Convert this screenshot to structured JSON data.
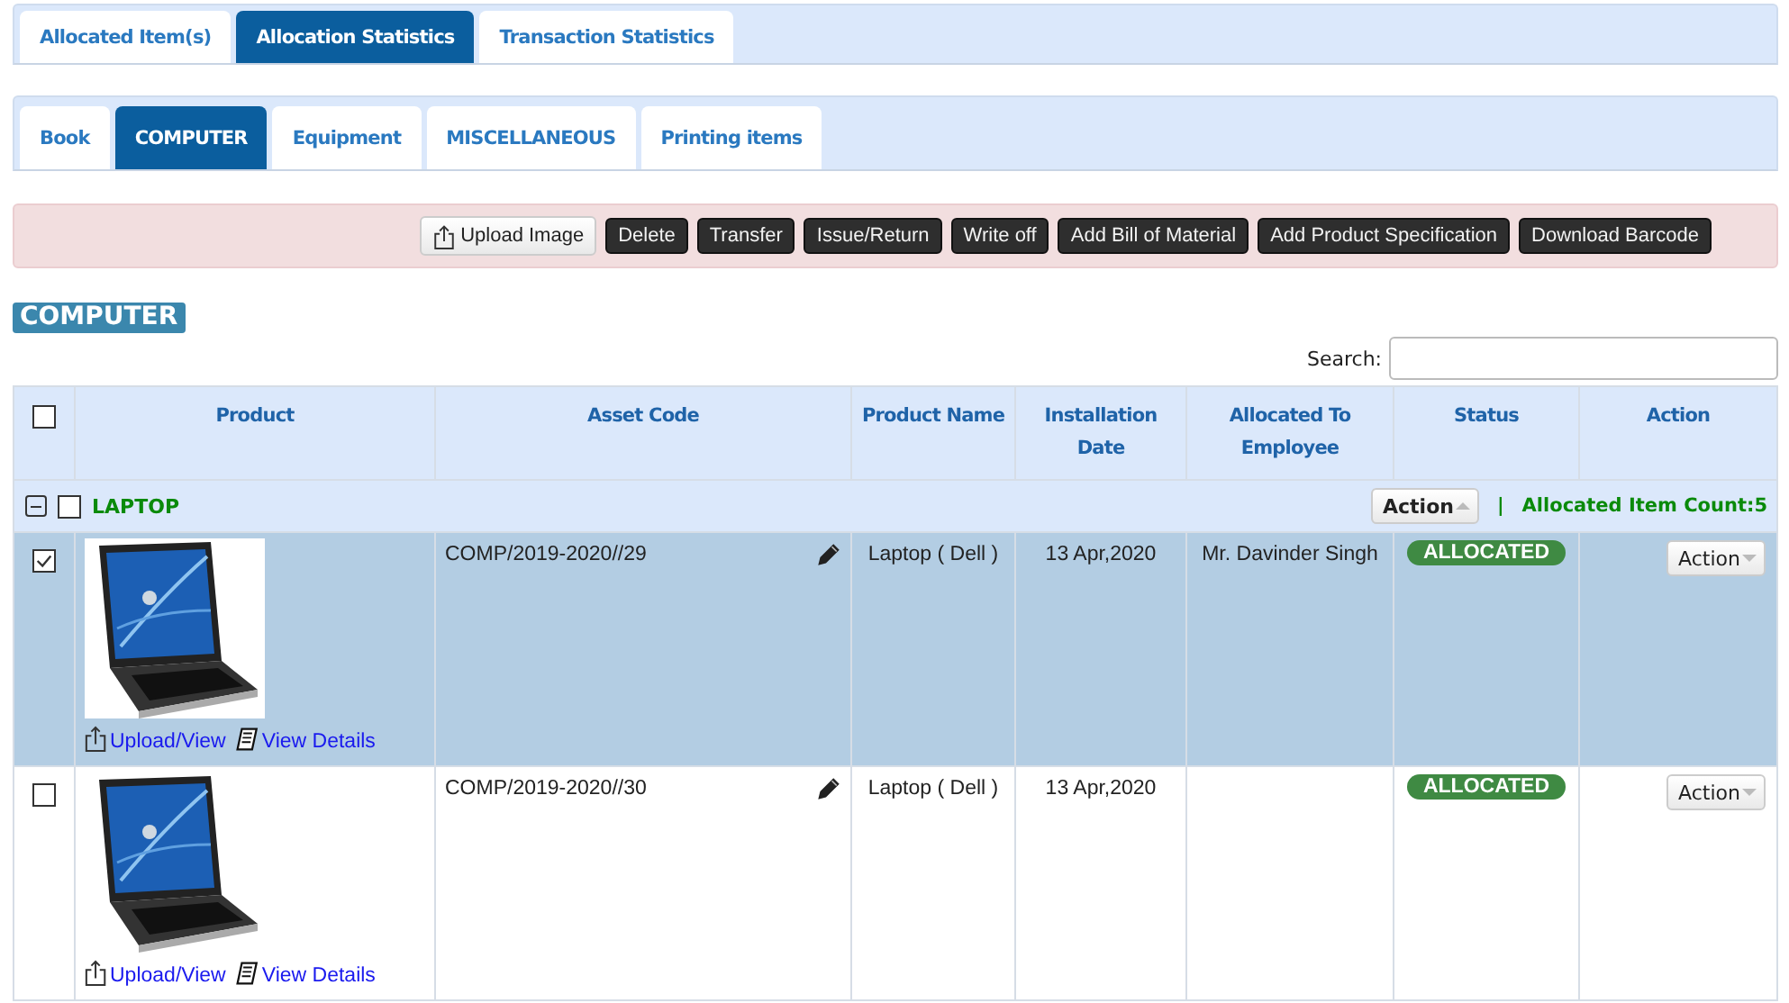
{
  "main_tabs": [
    {
      "label": "Allocated Item(s)",
      "selected": false
    },
    {
      "label": "Allocation Statistics",
      "selected": true
    },
    {
      "label": "Transaction Statistics",
      "selected": false
    }
  ],
  "category_tabs": [
    {
      "label": "Book",
      "selected": false
    },
    {
      "label": "COMPUTER",
      "selected": true
    },
    {
      "label": "Equipment",
      "selected": false
    },
    {
      "label": "MISCELLANEOUS",
      "selected": false
    },
    {
      "label": "Printing items",
      "selected": false
    }
  ],
  "toolbar": [
    {
      "label": "Upload Image",
      "kind": "upload"
    },
    {
      "label": "Delete",
      "kind": "dark"
    },
    {
      "label": "Transfer",
      "kind": "dark"
    },
    {
      "label": "Issue/Return",
      "kind": "dark"
    },
    {
      "label": "Write off",
      "kind": "dark"
    },
    {
      "label": "Add Bill of Material",
      "kind": "dark"
    },
    {
      "label": "Add Product Specification",
      "kind": "dark"
    },
    {
      "label": "Download Barcode",
      "kind": "dark"
    }
  ],
  "section_title": "COMPUTER",
  "search": {
    "label": "Search:"
  },
  "table": {
    "header_checked": false,
    "columns": [
      "Product",
      "Asset Code",
      "Product Name",
      "Installation Date",
      "Allocated To Employee",
      "Status",
      "Action"
    ],
    "group": {
      "name": "LAPTOP",
      "expanded": true,
      "checked": false,
      "action": "Action",
      "separator": "|",
      "count": "Allocated Item Count:5"
    },
    "rows": [
      {
        "selected": true,
        "checked": true,
        "upload_link": "Upload/View",
        "details_link": "View Details",
        "asset_code": "COMP/2019-2020//29",
        "product_name": "Laptop ( Dell )",
        "installation_date": "13 Apr,2020",
        "allocated_to": "Mr. Davinder Singh",
        "status": "ALLOCATED",
        "action": "Action"
      },
      {
        "selected": false,
        "checked": false,
        "upload_link": "Upload/View",
        "details_link": "View Details",
        "asset_code": "COMP/2019-2020//30",
        "product_name": "Laptop ( Dell )",
        "installation_date": "13 Apr,2020",
        "status": "ALLOCATED",
        "action": "Action"
      }
    ]
  }
}
